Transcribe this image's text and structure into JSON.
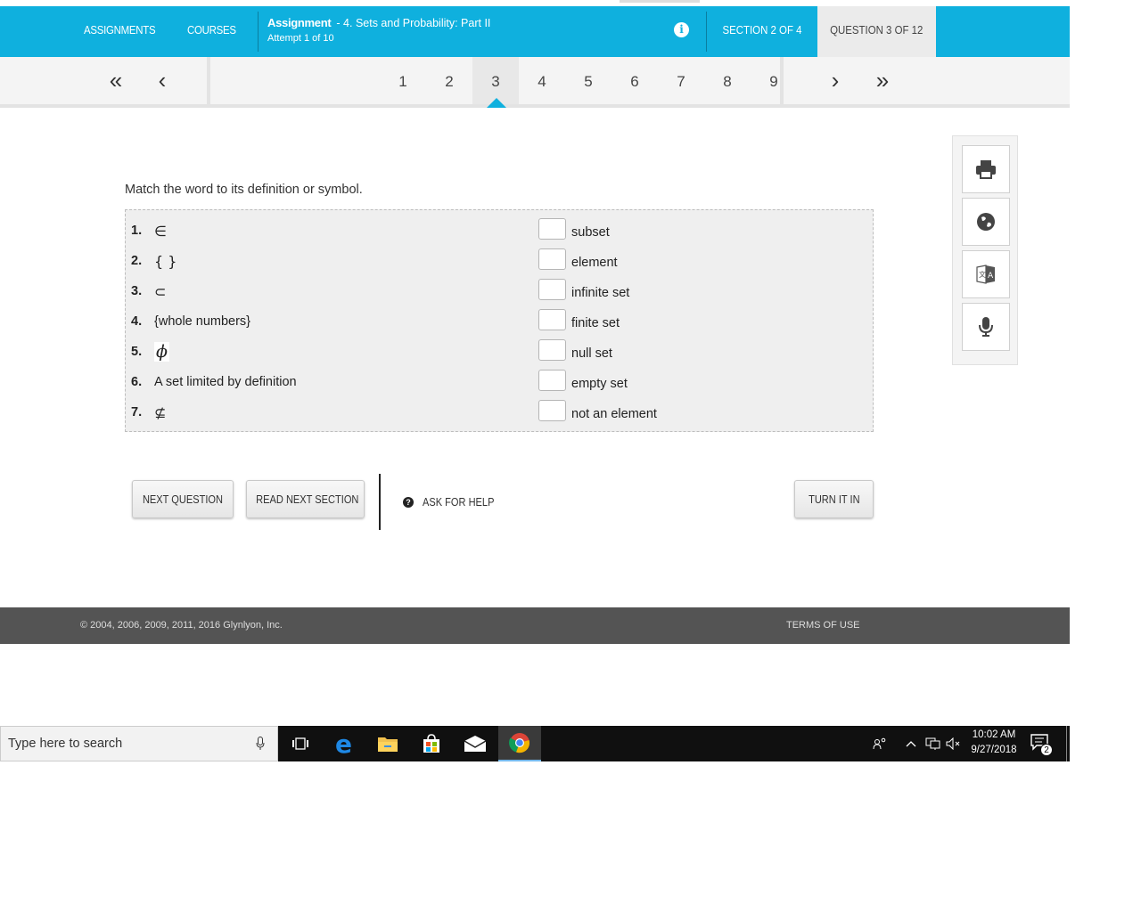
{
  "header": {
    "assignments_label": "ASSIGNMENTS",
    "courses_label": "COURSES",
    "assignment_word": "Assignment",
    "assignment_title": "- 4. Sets and Probability: Part II",
    "attempt": "Attempt 1 of 10",
    "section_indicator": "SECTION 2 OF 4",
    "question_indicator": "QUESTION 3 OF 12",
    "info_icon": "i"
  },
  "question_nav": {
    "first": "«",
    "prev": "‹",
    "next": "›",
    "last": "»",
    "numbers": [
      "1",
      "2",
      "3",
      "4",
      "5",
      "6",
      "7",
      "8",
      "9"
    ],
    "active": "3"
  },
  "question": {
    "prompt": "Match the word to its definition or symbol.",
    "left": [
      {
        "num": "1.",
        "text": "∈"
      },
      {
        "num": "2.",
        "text": "{ }"
      },
      {
        "num": "3.",
        "text": "⊂"
      },
      {
        "num": "4.",
        "text": "{whole numbers}"
      },
      {
        "num": "5.",
        "text": "ϕ"
      },
      {
        "num": "6.",
        "text": "A set limited by definition"
      },
      {
        "num": "7.",
        "text": "⊈"
      }
    ],
    "right": [
      {
        "answer": "",
        "text": "subset"
      },
      {
        "answer": "",
        "text": "element"
      },
      {
        "answer": "",
        "text": "infinite set"
      },
      {
        "answer": "",
        "text": "finite set"
      },
      {
        "answer": "",
        "text": "null set"
      },
      {
        "answer": "",
        "text": "empty set"
      },
      {
        "answer": "",
        "text": "not an element"
      }
    ]
  },
  "actions": {
    "next_question": "NEXT QUESTION",
    "read_next_section": "READ NEXT SECTION",
    "ask_for_help": "ASK FOR HELP",
    "turn_it_in": "TURN IT IN"
  },
  "tools": [
    "print-icon",
    "globe-icon",
    "translate-icon",
    "microphone-icon"
  ],
  "footer": {
    "copyright": "© 2004, 2006, 2009, 2011, 2016 Glynlyon, Inc.",
    "terms": "TERMS OF USE"
  },
  "taskbar": {
    "search_placeholder": "Type here to search",
    "time": "10:02 AM",
    "date": "9/27/2018",
    "notification_count": "2"
  },
  "colors": {
    "brand": "#0fb0de",
    "footer": "#545454",
    "taskbar": "#101010"
  }
}
